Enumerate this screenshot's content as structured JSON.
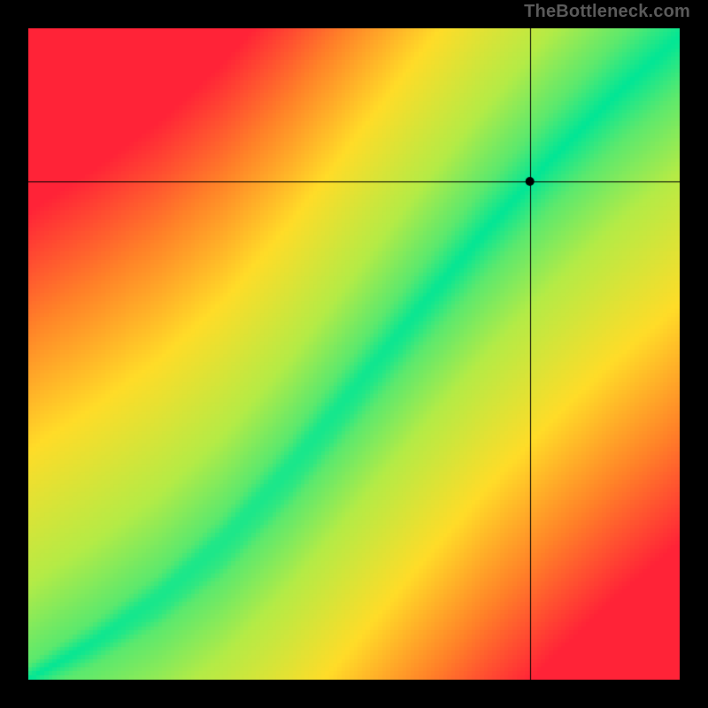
{
  "attribution": "TheBottleneck.com",
  "chart_data": {
    "type": "heatmap",
    "title": "",
    "xlabel": "",
    "ylabel": "",
    "xlim": [
      0,
      1
    ],
    "ylim": [
      0,
      1
    ],
    "grid": false,
    "legend": false,
    "resolution": 160,
    "band_half_width": 0.055,
    "transition_width": 0.12,
    "crosshair": {
      "x": 0.77,
      "y": 0.765
    },
    "marker": {
      "x": 0.77,
      "y": 0.765,
      "radius": 5
    },
    "curve_control_points": [
      {
        "t": 0.0,
        "y": 0.0
      },
      {
        "t": 0.1,
        "y": 0.055
      },
      {
        "t": 0.2,
        "y": 0.12
      },
      {
        "t": 0.3,
        "y": 0.205
      },
      {
        "t": 0.4,
        "y": 0.315
      },
      {
        "t": 0.5,
        "y": 0.44
      },
      {
        "t": 0.6,
        "y": 0.565
      },
      {
        "t": 0.7,
        "y": 0.685
      },
      {
        "t": 0.8,
        "y": 0.795
      },
      {
        "t": 0.9,
        "y": 0.895
      },
      {
        "t": 1.0,
        "y": 0.985
      }
    ],
    "palette_description": "green at optimal band center, through yellow, orange, to red at far distance",
    "palette_stops": [
      {
        "d": 0.0,
        "r": 0,
        "g": 230,
        "b": 150
      },
      {
        "d": 0.3,
        "r": 180,
        "g": 235,
        "b": 70
      },
      {
        "d": 0.55,
        "r": 255,
        "g": 220,
        "b": 40
      },
      {
        "d": 0.78,
        "r": 255,
        "g": 130,
        "b": 40
      },
      {
        "d": 1.0,
        "r": 255,
        "g": 35,
        "b": 55
      }
    ]
  }
}
